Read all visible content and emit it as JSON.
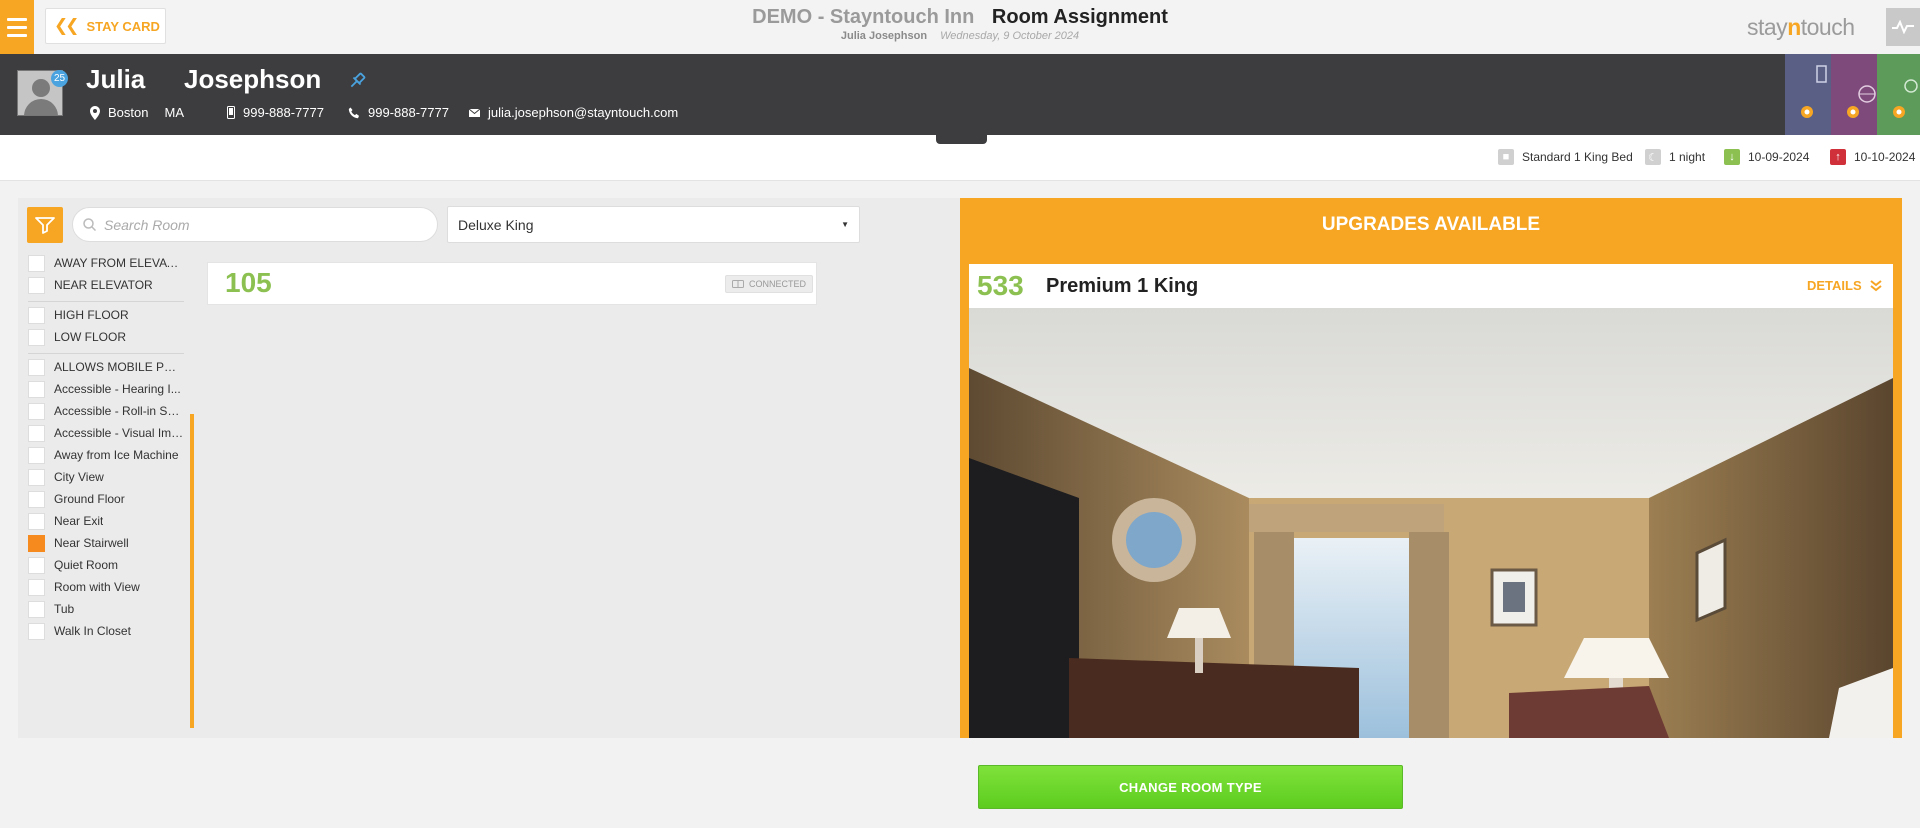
{
  "topbar": {
    "stay_card_label": "STAY CARD",
    "hotel_name": "DEMO - Stayntouch Inn",
    "page_title": "Room Assignment",
    "guest_name": "Julia Josephson",
    "date": "Wednesday, 9 October 2024",
    "brand_prefix": "stay",
    "brand_n": "n",
    "brand_suffix": "touch"
  },
  "guest": {
    "first_name": "Julia",
    "last_name": "Josephson",
    "age_badge": "25",
    "city": "Boston",
    "state": "MA",
    "mobile": "999-888-7777",
    "phone": "999-888-7777",
    "email": "julia.josephson@stayntouch.com"
  },
  "reservation": {
    "room_type": "Standard 1 King Bed",
    "nights": "1 night",
    "arrival": "10-09-2024",
    "departure": "10-10-2024"
  },
  "search": {
    "placeholder": "Search Room",
    "value": ""
  },
  "room_type_select": {
    "selected": "Deluxe King"
  },
  "features": [
    {
      "label": "AWAY FROM ELEVATOR",
      "checked": false
    },
    {
      "label": "NEAR ELEVATOR",
      "checked": false
    },
    {
      "label": "HIGH FLOOR",
      "checked": false
    },
    {
      "label": "LOW FLOOR",
      "checked": false
    },
    {
      "label": "ALLOWS MOBILE PHO...",
      "checked": false
    },
    {
      "label": "Accessible - Hearing I...",
      "checked": false
    },
    {
      "label": "Accessible - Roll-in Sh...",
      "checked": false
    },
    {
      "label": "Accessible - Visual Imp...",
      "checked": false
    },
    {
      "label": "Away from Ice Machine",
      "checked": false
    },
    {
      "label": "City View",
      "checked": false
    },
    {
      "label": "Ground Floor",
      "checked": false
    },
    {
      "label": "Near Exit",
      "checked": false
    },
    {
      "label": "Near Stairwell",
      "checked": true
    },
    {
      "label": "Quiet Room",
      "checked": false
    },
    {
      "label": "Room with View",
      "checked": false
    },
    {
      "label": "Tub",
      "checked": false
    },
    {
      "label": "Walk In Closet",
      "checked": false
    }
  ],
  "rooms": [
    {
      "number": "105",
      "tag": "CONNECTED"
    }
  ],
  "upgrades": {
    "title": "UPGRADES AVAILABLE",
    "items": [
      {
        "number": "533",
        "name": "Premium 1 King",
        "details_label": "DETAILS"
      }
    ]
  },
  "actions": {
    "change_room_type": "CHANGE ROOM TYPE"
  },
  "colors": {
    "accent": "#f6a623",
    "green": "#8cc152",
    "header_dark": "#3d3d3f",
    "button_green": "#6fd72a"
  }
}
